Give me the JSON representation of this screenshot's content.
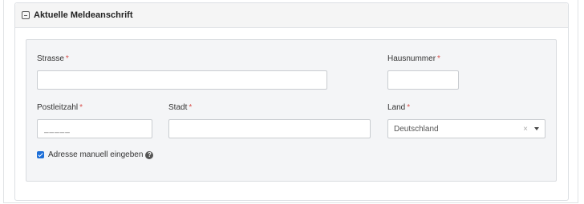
{
  "panel": {
    "title": "Aktuelle Meldeanschrift"
  },
  "fields": {
    "strasse": {
      "label": "Strasse",
      "value": ""
    },
    "hausnummer": {
      "label": "Hausnummer",
      "value": ""
    },
    "postleitzahl": {
      "label": "Postleitzahl",
      "placeholder": "_____"
    },
    "stadt": {
      "label": "Stadt",
      "value": ""
    },
    "land": {
      "label": "Land",
      "value": "Deutschland",
      "clear": "×"
    }
  },
  "required_marker": "*",
  "checkbox": {
    "label": "Adresse manuell eingeben",
    "checked": true,
    "help": "?"
  },
  "colors": {
    "accent": "#1d6fd8",
    "required": "#d9534f",
    "form_bg": "#f4f5f7"
  }
}
